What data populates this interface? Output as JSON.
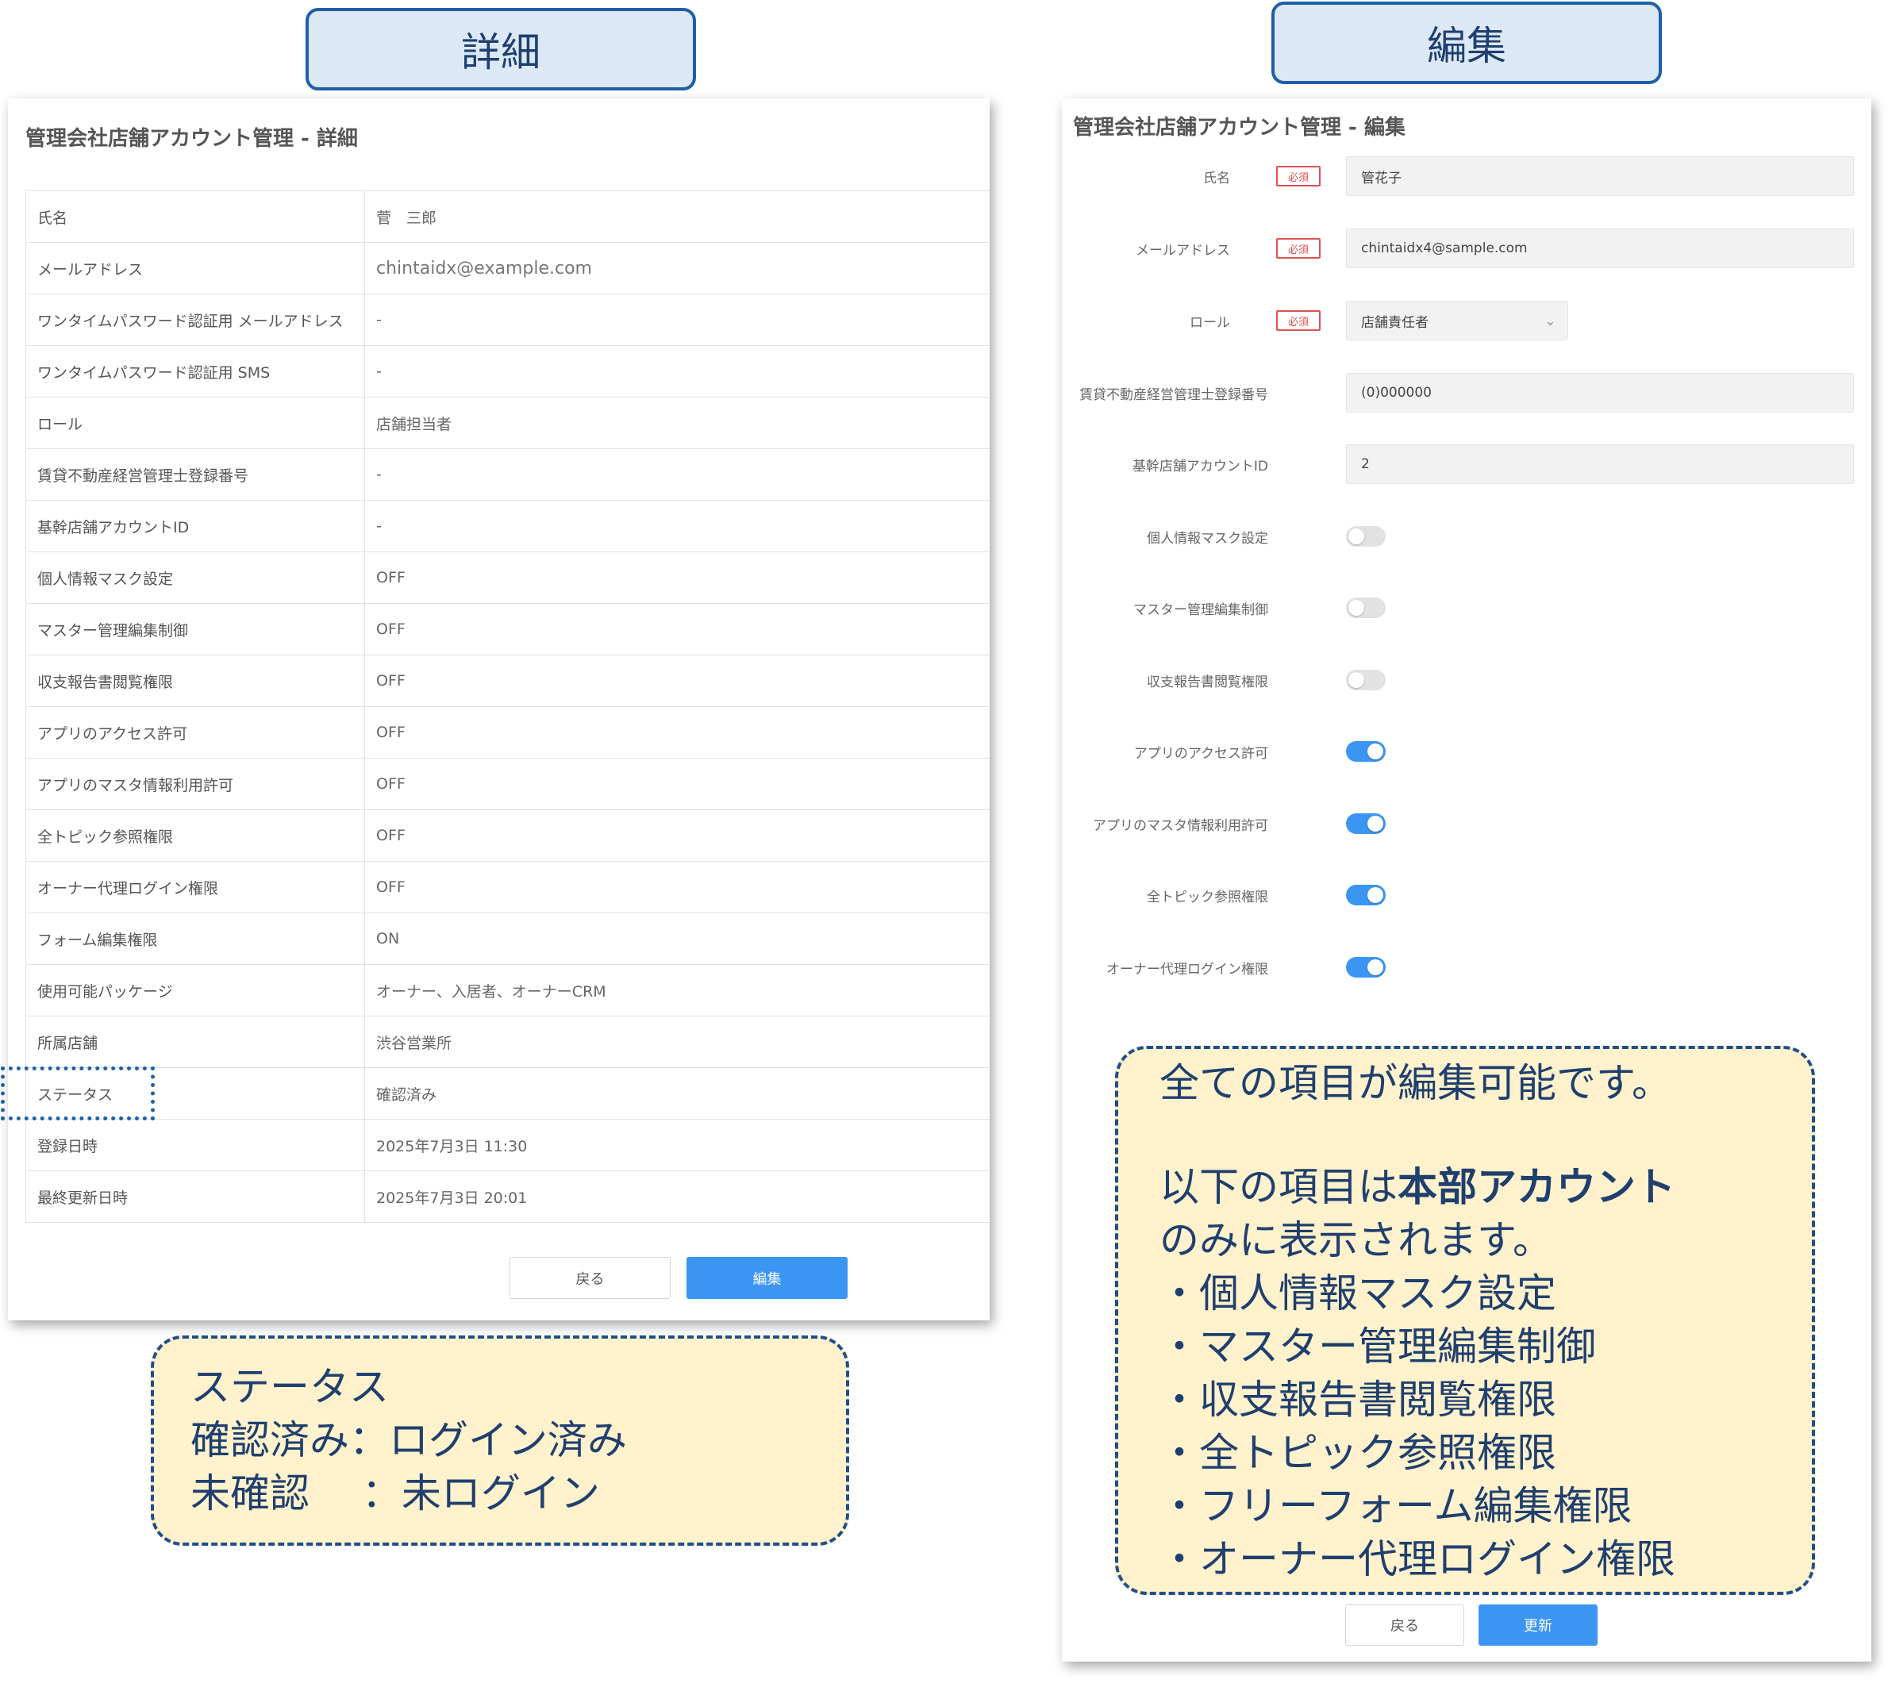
{
  "tabs": {
    "detail": "詳細",
    "edit": "編集"
  },
  "detail": {
    "title": "管理会社店舗アカウント管理 - 詳細",
    "rows": [
      {
        "label": "氏名",
        "value": "菅　三郎"
      },
      {
        "label": "メールアドレス",
        "value": "chintaidx@example.com"
      },
      {
        "label": "ワンタイムパスワード認証用 メールアドレス",
        "value": "-"
      },
      {
        "label": "ワンタイムパスワード認証用 SMS",
        "value": "-"
      },
      {
        "label": "ロール",
        "value": "店舗担当者"
      },
      {
        "label": "賃貸不動産経営管理士登録番号",
        "value": "-"
      },
      {
        "label": "基幹店舗アカウントID",
        "value": "-"
      },
      {
        "label": "個人情報マスク設定",
        "value": "OFF"
      },
      {
        "label": "マスター管理編集制御",
        "value": "OFF"
      },
      {
        "label": "収支報告書閲覧権限",
        "value": "OFF"
      },
      {
        "label": "アプリのアクセス許可",
        "value": "OFF"
      },
      {
        "label": "アプリのマスタ情報利用許可",
        "value": "OFF"
      },
      {
        "label": "全トピック参照権限",
        "value": "OFF"
      },
      {
        "label": "オーナー代理ログイン権限",
        "value": "OFF"
      },
      {
        "label": "フォーム編集権限",
        "value": "ON"
      },
      {
        "label": "使用可能パッケージ",
        "value": "オーナー、入居者、オーナーCRM"
      },
      {
        "label": "所属店舗",
        "value": "渋谷営業所"
      },
      {
        "label": "ステータス",
        "value": "確認済み"
      },
      {
        "label": "登録日時",
        "value": "2025年7月3日 11:30"
      },
      {
        "label": "最終更新日時",
        "value": "2025年7月3日 20:01"
      }
    ],
    "back_label": "戻る",
    "edit_label": "編集"
  },
  "status_callout": {
    "lines": [
      "ステータス",
      "確認済み：ログイン済み",
      "未確認　 ：未ログイン"
    ]
  },
  "edit": {
    "title": "管理会社店舗アカウント管理 - 編集",
    "required_badge": "必須",
    "fields": [
      {
        "label": "氏名",
        "required": true,
        "type": "text",
        "value": "管花子"
      },
      {
        "label": "メールアドレス",
        "required": true,
        "type": "text",
        "value": "chintaidx4@sample.com"
      },
      {
        "label": "ロール",
        "required": true,
        "type": "select",
        "value": "店舗責任者"
      },
      {
        "label": "賃貸不動産経営管理士登録番号",
        "required": false,
        "type": "text",
        "value": "(0)000000"
      },
      {
        "label": "基幹店舗アカウントID",
        "required": false,
        "type": "text",
        "value": "2"
      },
      {
        "label": "個人情報マスク設定",
        "required": false,
        "type": "toggle",
        "on": false
      },
      {
        "label": "マスター管理編集制御",
        "required": false,
        "type": "toggle",
        "on": false
      },
      {
        "label": "収支報告書閲覧権限",
        "required": false,
        "type": "toggle",
        "on": false
      },
      {
        "label": "アプリのアクセス許可",
        "required": false,
        "type": "toggle",
        "on": true
      },
      {
        "label": "アプリのマスタ情報利用許可",
        "required": false,
        "type": "toggle",
        "on": true
      },
      {
        "label": "全トピック参照権限",
        "required": false,
        "type": "toggle",
        "on": true
      },
      {
        "label": "オーナー代理ログイン権限",
        "required": false,
        "type": "toggle",
        "on": true
      }
    ],
    "back_label": "戻る",
    "update_label": "更新"
  },
  "edit_callout": {
    "line1": "全ての項目が編集可能です。",
    "line2_prefix": "以下の項目は",
    "line2_bold": "本部アカウント",
    "line3": "のみに表示されます。",
    "items": [
      "・個人情報マスク設定",
      "・マスター管理編集制御",
      "・収支報告書閲覧権限",
      "・全トピック参照権限",
      "・フリーフォーム編集権限",
      "・オーナー代理ログイン権限"
    ]
  },
  "colors": {
    "primary": "#3b95f3",
    "callout_bg": "#fff2cc",
    "callout_border": "#1f4e8c",
    "required": "#e05252"
  }
}
